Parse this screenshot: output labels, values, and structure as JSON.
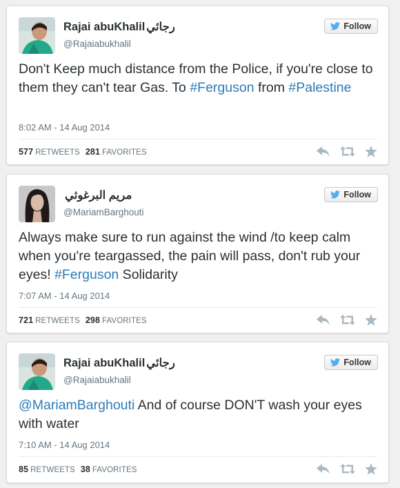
{
  "tweets": [
    {
      "name": "Rajai abuKhalil",
      "name_ar": "رجائي",
      "handle": "@Rajaiabukhalil",
      "follow_label": "Follow",
      "text_parts": {
        "p1": "Don't Keep much distance from the Police, if you're close to them they can't tear Gas. To ",
        "l1": "#Ferguson",
        "p2": " from ",
        "l2": "#Palestine"
      },
      "date": "8:02 AM - 14 Aug 2014",
      "retweets": "577",
      "retweets_label": "RETWEETS",
      "favorites": "281",
      "favorites_label": "FAVORITES"
    },
    {
      "name": "",
      "name_ar": "مريم البرغوثي",
      "handle": "@MariamBarghouti",
      "follow_label": "Follow",
      "text_parts": {
        "p1": "Always make sure to run against the wind /to keep calm when you're teargassed, the pain will pass, don't rub your eyes! ",
        "l1": "#Ferguson",
        "p2": " Solidarity"
      },
      "date": "7:07 AM - 14 Aug 2014",
      "retweets": "721",
      "retweets_label": "RETWEETS",
      "favorites": "298",
      "favorites_label": "FAVORITES"
    },
    {
      "name": "Rajai abuKhalil",
      "name_ar": "رجائي",
      "handle": "@Rajaiabukhalil",
      "follow_label": "Follow",
      "text_parts": {
        "l1": "@MariamBarghouti",
        "p1": " And of course DON'T wash your eyes with water"
      },
      "date": "7:10 AM - 14 Aug 2014",
      "retweets": "85",
      "retweets_label": "RETWEETS",
      "favorites": "38",
      "favorites_label": "FAVORITES"
    }
  ],
  "icons": {
    "follow": "twitter-bird-icon",
    "reply": "reply-icon",
    "retweet": "retweet-icon",
    "favorite": "star-icon"
  },
  "colors": {
    "link": "#2b7bb9",
    "muted": "#66757f",
    "action_icon": "#aab8c2"
  }
}
